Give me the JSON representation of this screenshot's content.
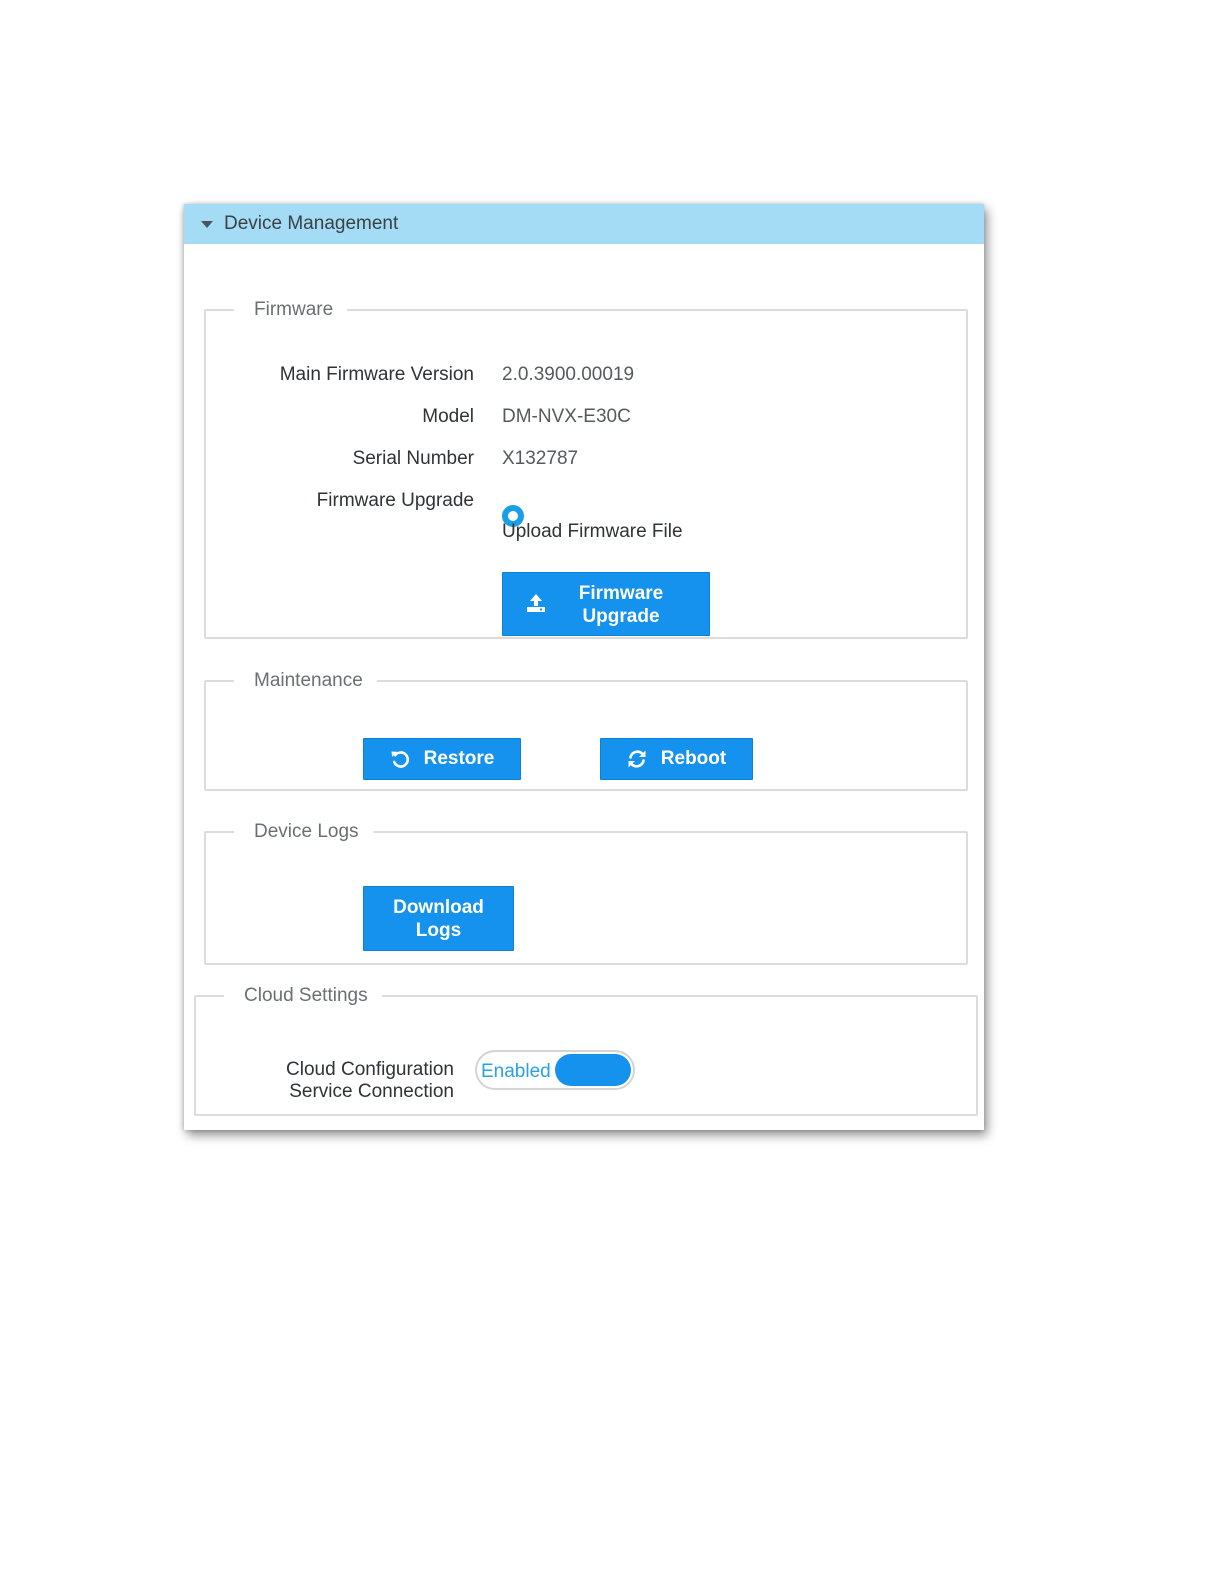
{
  "header": {
    "title": "Device Management",
    "icon": "caret-down-icon"
  },
  "firmware": {
    "legend": "Firmware",
    "rows": [
      {
        "label": "Main Firmware Version",
        "value": "2.0.3900.00019"
      },
      {
        "label": "Model",
        "value": "DM-NVX-E30C"
      },
      {
        "label": "Serial Number",
        "value": "X132787"
      }
    ],
    "upgrade_label": "Firmware Upgrade",
    "upload_option": "Upload Firmware File",
    "button_line1": "Firmware",
    "button_line2": "Upgrade",
    "button_icon": "upload-icon"
  },
  "maintenance": {
    "legend": "Maintenance",
    "restore_label": "Restore",
    "restore_icon": "undo-icon",
    "reboot_label": "Reboot",
    "reboot_icon": "refresh-icon"
  },
  "device_logs": {
    "legend": "Device Logs",
    "button_line1": "Download",
    "button_line2": "Logs"
  },
  "cloud": {
    "legend": "Cloud Settings",
    "label_line1": "Cloud Configuration",
    "label_line2": "Service Connection",
    "toggle_text": "Enabled",
    "toggle_on": true
  },
  "colors": {
    "header_bg": "#a3dcf4",
    "button_bg": "#1592ee",
    "toggle_text": "#28a3dd"
  }
}
